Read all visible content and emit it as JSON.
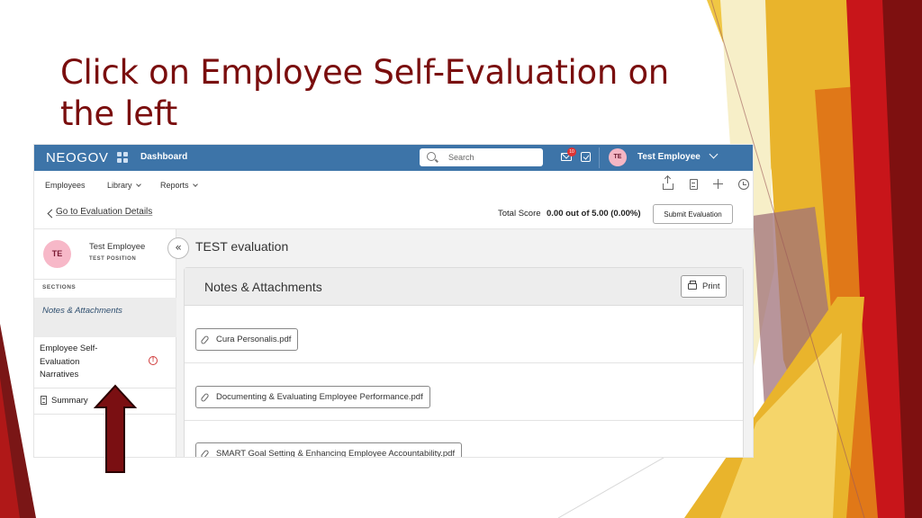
{
  "slide": {
    "title": "Click on Employee Self-Evaluation on the left"
  },
  "colors": {
    "title": "#7a0e0e",
    "navbar": "#3d74a8",
    "arrow": "#7a0f12",
    "accent_gold": "#e0b12a",
    "accent_red": "#c8151a"
  },
  "app": {
    "logo": "NEOGOV",
    "nav_dashboard": "Dashboard",
    "search_placeholder": "Search",
    "mail_badge": "10",
    "user_initials": "TE",
    "user_name": "Test Employee",
    "menu": [
      "Employees",
      "Library",
      "Reports"
    ],
    "tool_icons": [
      "share-icon",
      "document-icon",
      "plus-icon",
      "history-icon"
    ]
  },
  "eval": {
    "back_link": "Go to Evaluation Details",
    "score_label": "Total Score",
    "score_value": "0.00 out of 5.00 (0.00%)",
    "submit_label": "Submit Evaluation",
    "title": "TEST evaluation"
  },
  "sidebar": {
    "initials": "TE",
    "name": "Test Employee",
    "position": "TEST POSITION",
    "collapse_glyph": "«",
    "sections_label": "SECTIONS",
    "active_item": "Notes & Attachments",
    "item_self_eval": "Employee Self-Evaluation Narratives",
    "warning_glyph": "!",
    "item_summary": "Summary"
  },
  "panel": {
    "title": "Notes & Attachments",
    "print_label": "Print",
    "attachments": [
      "Cura Personalis.pdf",
      "Documenting & Evaluating Employee Performance.pdf",
      "SMART Goal Setting & Enhancing Employee Accountability.pdf"
    ]
  }
}
